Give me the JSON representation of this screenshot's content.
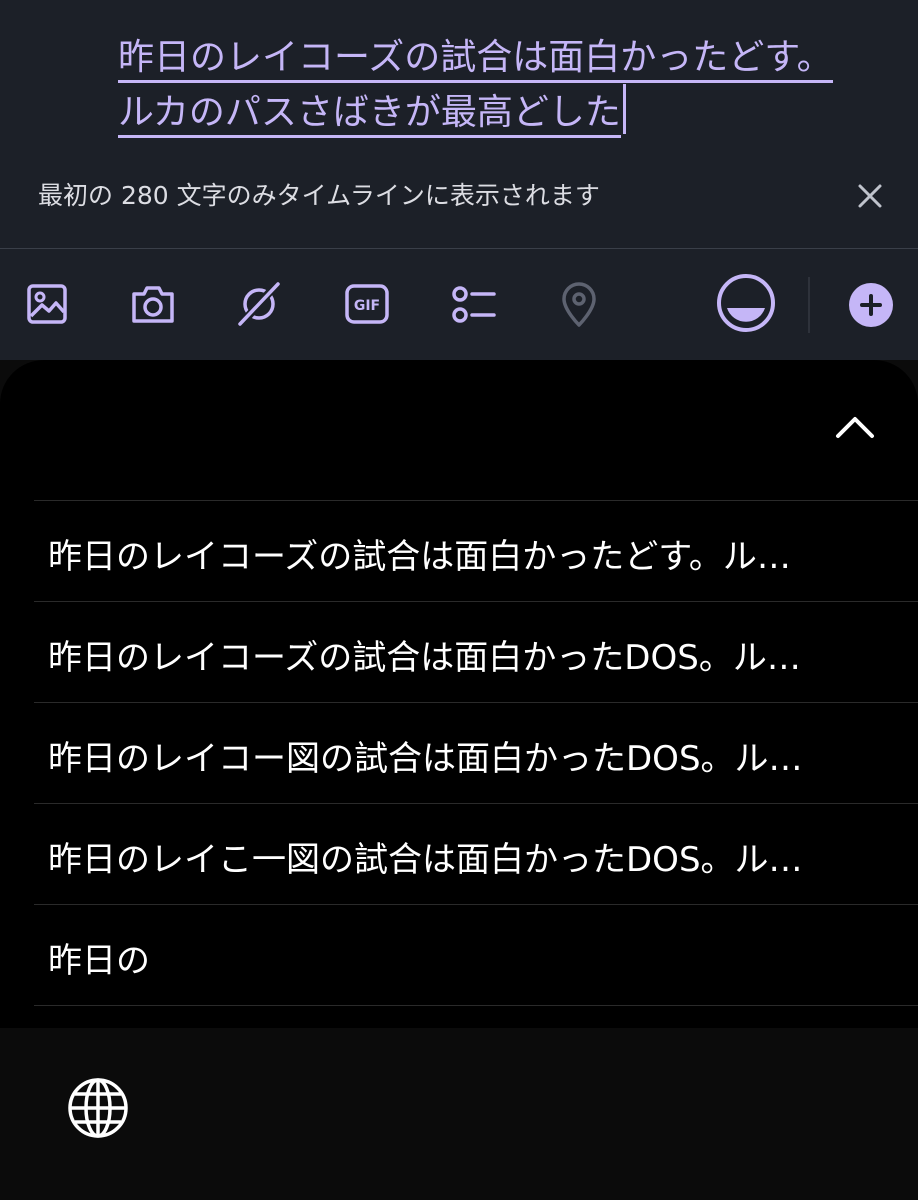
{
  "compose": {
    "line1": "昨日のレイコーズの試合は面白かったどす。",
    "line2": "ルカのパスさばきが最高どした"
  },
  "notice": {
    "text": "最初の 280 文字のみタイムラインに表示されます"
  },
  "toolbar": {
    "icons": [
      "image-icon",
      "camera-icon",
      "grok-icon",
      "gif-icon",
      "poll-icon",
      "location-icon",
      "char-counter-ring-icon",
      "add-post-icon"
    ],
    "gif_label": "GIF"
  },
  "suggestions": [
    "昨日のレイコーズの試合は面白かったどす。ル…",
    "昨日のレイコーズの試合は面白かったDOS。ル…",
    "昨日のレイコー図の試合は面白かったDOS。ル…",
    "昨日のレイこ一図の試合は面白かったDOS。ル…",
    "昨日の"
  ],
  "colors": {
    "accent": "#c5b6f7",
    "compose_bg": "#1c2028",
    "sheet_bg": "#000000"
  }
}
